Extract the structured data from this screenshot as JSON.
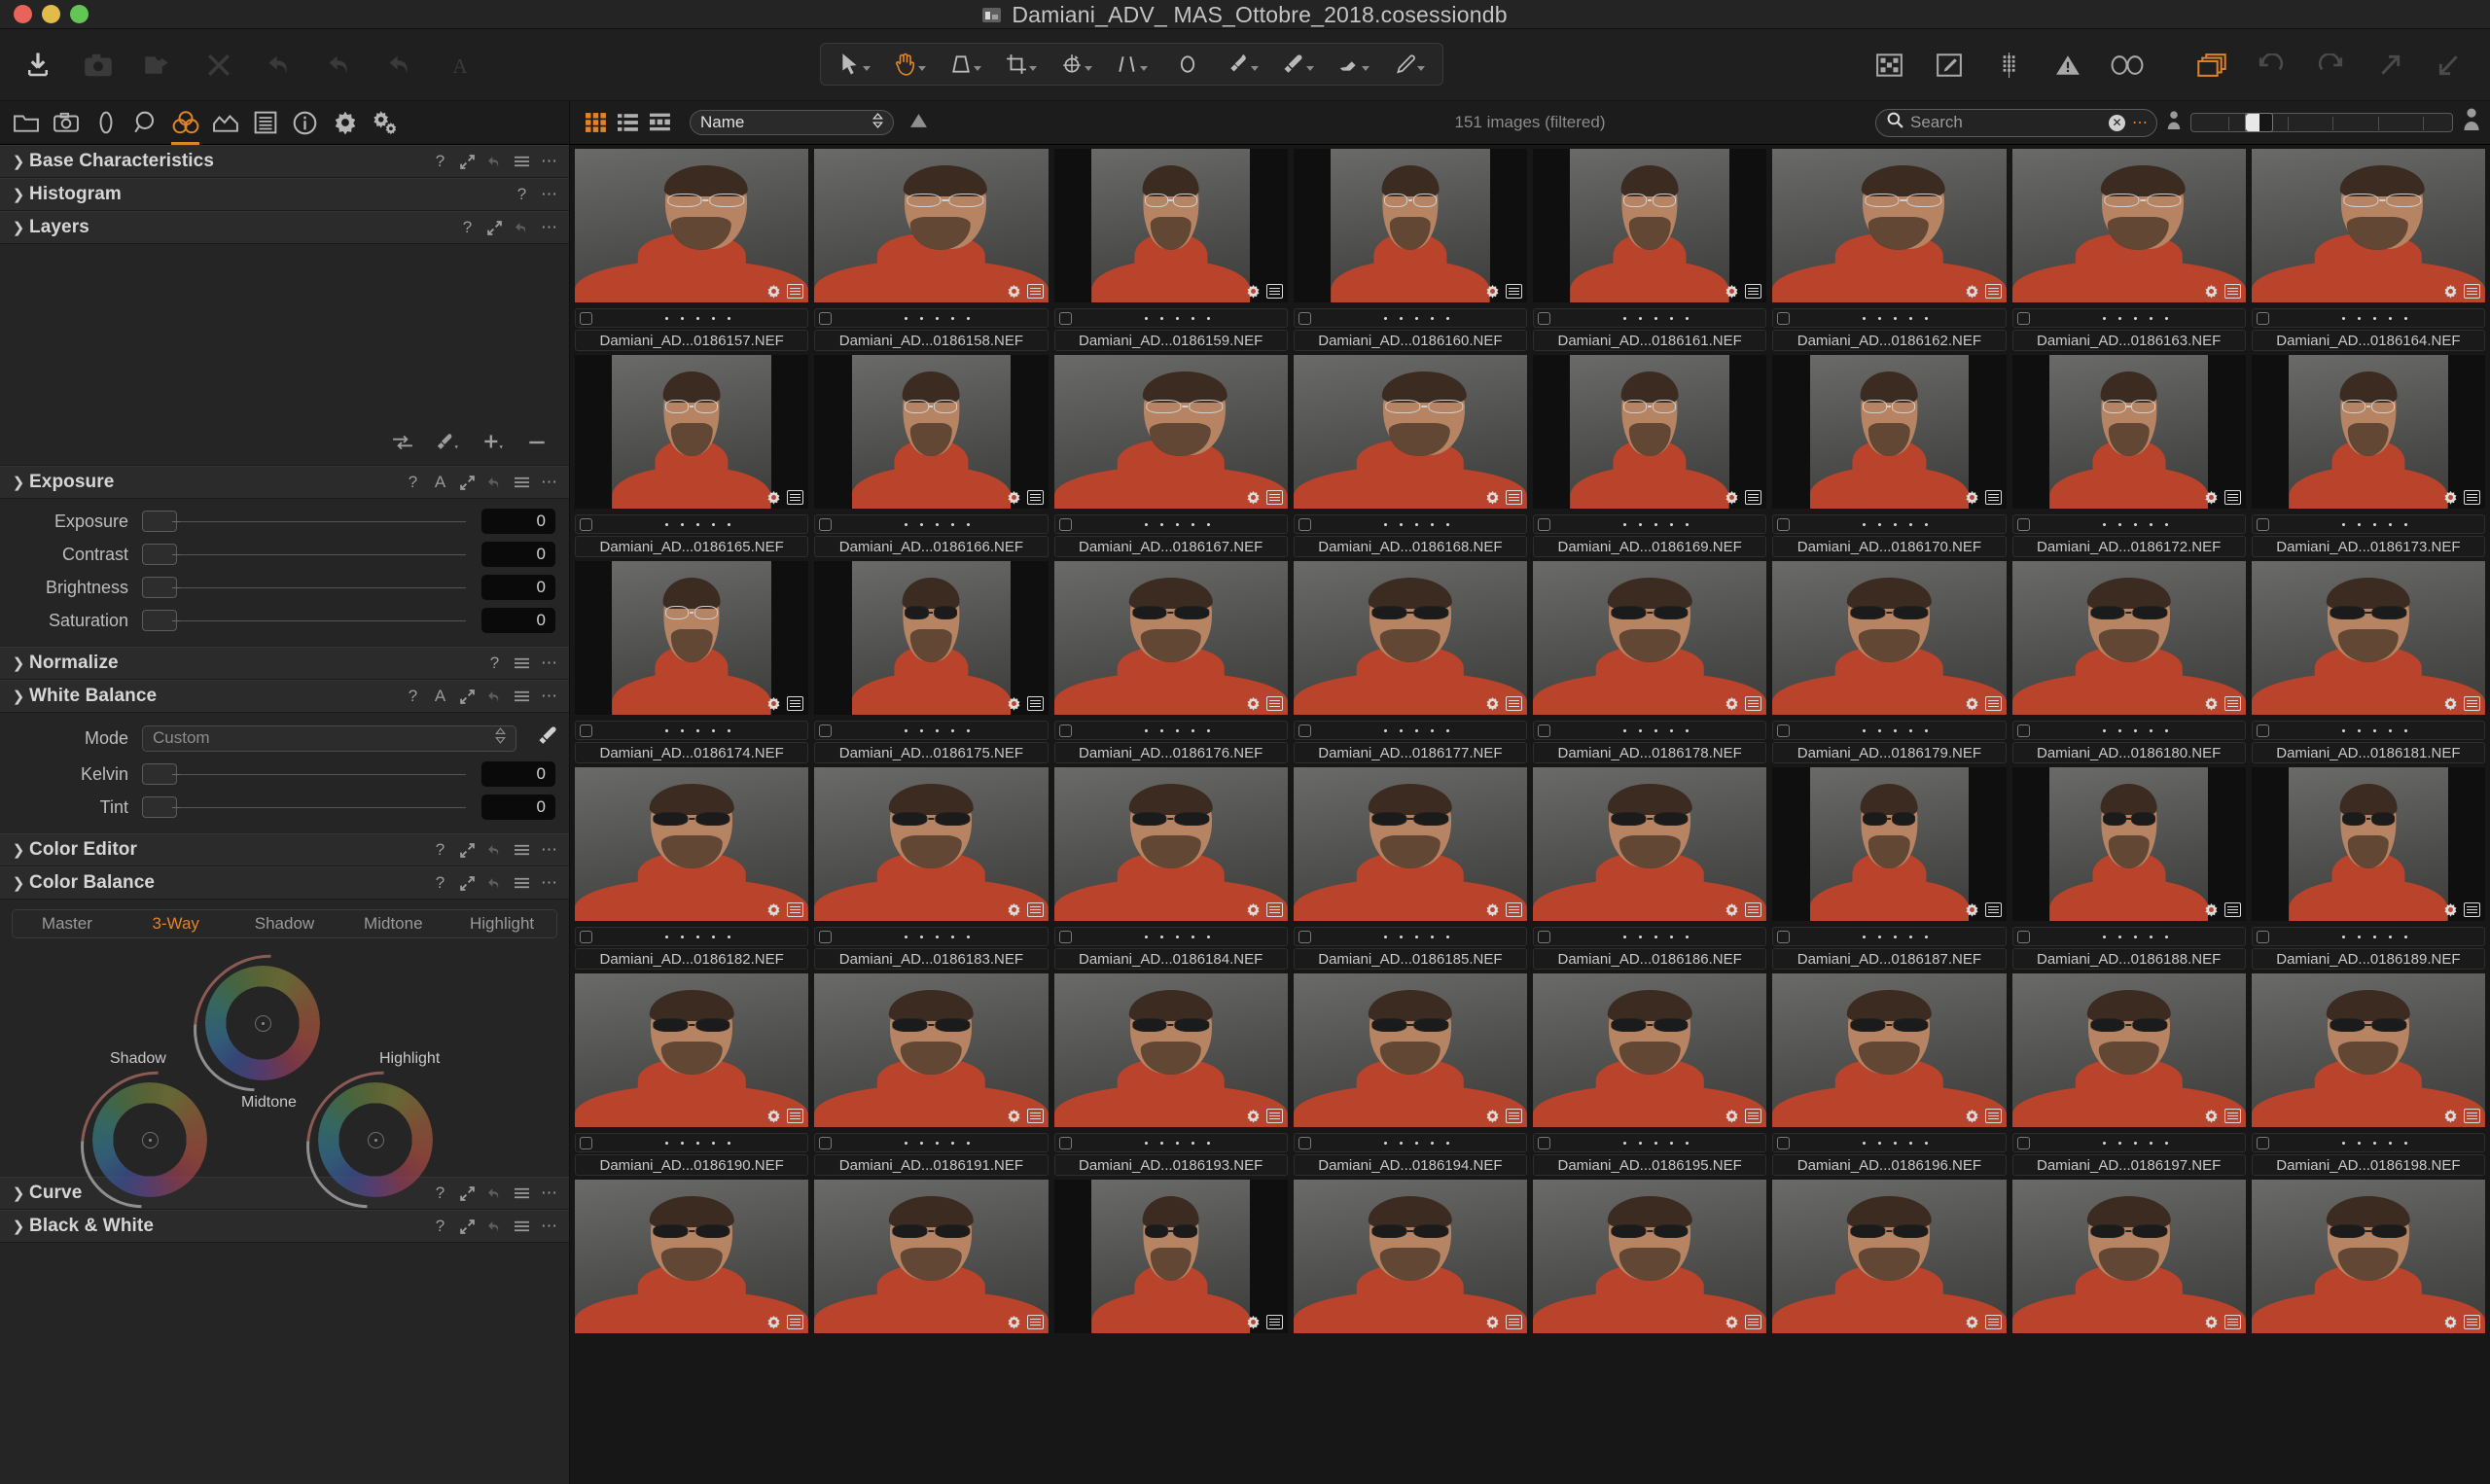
{
  "window": {
    "title": "Damiani_ADV_ MAS_Ottobre_2018.cosessiondb",
    "traffic": [
      "close",
      "minimize",
      "zoom"
    ]
  },
  "main_toolbar": {
    "left_buttons": [
      {
        "name": "import-images",
        "icon": "download-arrow",
        "state": "enabled"
      },
      {
        "name": "capture",
        "icon": "camera",
        "state": "disabled"
      },
      {
        "name": "export-originals",
        "icon": "folder-arrow",
        "state": "disabled"
      },
      {
        "name": "delete",
        "icon": "x-mark",
        "state": "disabled"
      },
      {
        "name": "rotate-left",
        "icon": "undo-arrow",
        "state": "disabled"
      },
      {
        "name": "rotate-right",
        "icon": "redo-arrow",
        "state": "disabled"
      },
      {
        "name": "flip",
        "icon": "curve-arrow",
        "state": "disabled"
      },
      {
        "name": "annotate",
        "icon": "letter-a",
        "state": "disabled"
      }
    ],
    "tools": [
      {
        "name": "select-tool",
        "icon": "cursor-arrow",
        "active": false,
        "has_caret": true
      },
      {
        "name": "pan-tool",
        "icon": "hand",
        "active": true,
        "has_caret": true
      },
      {
        "name": "transform-tool",
        "icon": "keystone",
        "active": false,
        "has_caret": true
      },
      {
        "name": "crop-tool",
        "icon": "crop",
        "active": false,
        "has_caret": true
      },
      {
        "name": "rotate-tool",
        "icon": "rotate-target",
        "active": false,
        "has_caret": true
      },
      {
        "name": "keystone-tool",
        "icon": "parallel-lines",
        "active": false,
        "has_caret": true
      },
      {
        "name": "spot-removal-tool",
        "icon": "circle",
        "active": false,
        "has_caret": false
      },
      {
        "name": "draw-mask-tool",
        "icon": "brush",
        "active": false,
        "has_caret": true
      },
      {
        "name": "color-picker-tool",
        "icon": "eyedropper",
        "active": false,
        "has_caret": true
      },
      {
        "name": "erase-mask-tool",
        "icon": "eraser",
        "active": false,
        "has_caret": true
      },
      {
        "name": "heal-tool",
        "icon": "pen",
        "active": false,
        "has_caret": true
      }
    ],
    "right_buttons": [
      {
        "name": "viewer-toggle",
        "icon": "grid-viewer",
        "state": "enabled"
      },
      {
        "name": "edit-mode",
        "icon": "pencil-box",
        "state": "enabled"
      },
      {
        "name": "grid-overlay",
        "icon": "halftone-grid",
        "state": "enabled"
      },
      {
        "name": "exposure-warning",
        "icon": "warning-triangle",
        "state": "enabled"
      },
      {
        "name": "focus-mask",
        "icon": "glasses",
        "state": "enabled"
      },
      {
        "name": "variants",
        "icon": "stacked-layers",
        "state": "active"
      },
      {
        "name": "undo",
        "icon": "undo-circle",
        "state": "disabled"
      },
      {
        "name": "redo",
        "icon": "redo-circle",
        "state": "disabled"
      },
      {
        "name": "expand-panel",
        "icon": "arrow-up-right",
        "state": "disabled"
      },
      {
        "name": "collapse-panel",
        "icon": "arrow-down-left",
        "state": "disabled"
      }
    ]
  },
  "tool_tabs": [
    {
      "name": "library",
      "icon": "folder",
      "active": false
    },
    {
      "name": "capture",
      "icon": "camera",
      "active": false
    },
    {
      "name": "lens",
      "icon": "lens",
      "active": false
    },
    {
      "name": "details",
      "icon": "magnifier",
      "active": false
    },
    {
      "name": "color",
      "icon": "color-circles",
      "active": true
    },
    {
      "name": "exposure",
      "icon": "histogram-curve",
      "active": false
    },
    {
      "name": "metadata",
      "icon": "document-lines",
      "active": false
    },
    {
      "name": "adjustments",
      "icon": "info-circle",
      "active": false
    },
    {
      "name": "output",
      "icon": "gear",
      "active": false
    },
    {
      "name": "batch",
      "icon": "gears",
      "active": false
    }
  ],
  "panels": [
    {
      "title": "Base Characteristics",
      "expanded": false,
      "icons": [
        "help",
        "expand",
        "reset",
        "menu",
        "more"
      ]
    },
    {
      "title": "Histogram",
      "expanded": false,
      "icons": [
        "help",
        "more"
      ]
    },
    {
      "title": "Layers",
      "expanded": true,
      "icons": [
        "help",
        "expand",
        "reset",
        "more"
      ]
    }
  ],
  "layers": {
    "tool_icons": [
      "fill-mask",
      "brush",
      "add-layer",
      "remove-layer"
    ]
  },
  "exposure_panel": {
    "title": "Exposure",
    "expanded": true,
    "icons": [
      "help",
      "auto",
      "expand",
      "reset",
      "menu",
      "more"
    ],
    "sliders": [
      {
        "label": "Exposure",
        "value": "0"
      },
      {
        "label": "Contrast",
        "value": "0"
      },
      {
        "label": "Brightness",
        "value": "0"
      },
      {
        "label": "Saturation",
        "value": "0"
      }
    ]
  },
  "normalize_panel": {
    "title": "Normalize",
    "expanded": false,
    "icons": [
      "help",
      "menu",
      "more"
    ]
  },
  "white_balance_panel": {
    "title": "White Balance",
    "expanded": true,
    "icons": [
      "help",
      "auto",
      "expand",
      "reset",
      "menu",
      "more"
    ],
    "mode_label": "Mode",
    "mode_value": "Custom",
    "sliders": [
      {
        "label": "Kelvin",
        "value": "0"
      },
      {
        "label": "Tint",
        "value": "0"
      }
    ]
  },
  "color_editor_panel": {
    "title": "Color Editor",
    "expanded": false,
    "icons": [
      "help",
      "expand",
      "reset",
      "menu",
      "more"
    ]
  },
  "color_balance_panel": {
    "title": "Color Balance",
    "expanded": true,
    "icons": [
      "help",
      "expand",
      "reset",
      "menu",
      "more"
    ],
    "tabs": [
      {
        "label": "Master",
        "active": false
      },
      {
        "label": "3-Way",
        "active": true
      },
      {
        "label": "Shadow",
        "active": false
      },
      {
        "label": "Midtone",
        "active": false
      },
      {
        "label": "Highlight",
        "active": false
      }
    ],
    "wheels": [
      {
        "label": "Midtone"
      },
      {
        "label": "Shadow"
      },
      {
        "label": "Highlight"
      }
    ]
  },
  "curve_panel": {
    "title": "Curve",
    "expanded": false,
    "icons": [
      "help",
      "expand",
      "reset",
      "menu",
      "more"
    ]
  },
  "black_white_panel": {
    "title": "Black & White",
    "expanded": false,
    "icons": [
      "help",
      "expand",
      "reset",
      "menu",
      "more"
    ]
  },
  "browser": {
    "view_modes": [
      {
        "name": "grid-view",
        "active": true
      },
      {
        "name": "list-view",
        "active": false
      },
      {
        "name": "filmstrip-view",
        "active": false
      }
    ],
    "sort_field": "Name",
    "sort_direction": "ascending",
    "count_text": "151 images (filtered)",
    "search_placeholder": "Search",
    "search_value": "",
    "zoom_level": 20
  },
  "accent_color": "#e08427",
  "thumbnails": [
    {
      "filename": "Damiani_AD...0186157.NEF",
      "rating": 0,
      "checked": false,
      "pose": "glasses-left",
      "aspect": "landscape"
    },
    {
      "filename": "Damiani_AD...0186158.NEF",
      "rating": 0,
      "checked": false,
      "pose": "glasses-left",
      "aspect": "landscape"
    },
    {
      "filename": "Damiani_AD...0186159.NEF",
      "rating": 0,
      "checked": false,
      "pose": "glasses-front",
      "aspect": "portrait"
    },
    {
      "filename": "Damiani_AD...0186160.NEF",
      "rating": 0,
      "checked": false,
      "pose": "glasses-front",
      "aspect": "portrait"
    },
    {
      "filename": "Damiani_AD...0186161.NEF",
      "rating": 0,
      "checked": false,
      "pose": "glasses-front",
      "aspect": "portrait"
    },
    {
      "filename": "Damiani_AD...0186162.NEF",
      "rating": 0,
      "checked": false,
      "pose": "glasses-left",
      "aspect": "landscape"
    },
    {
      "filename": "Damiani_AD...0186163.NEF",
      "rating": 0,
      "checked": false,
      "pose": "glasses-left",
      "aspect": "landscape"
    },
    {
      "filename": "Damiani_AD...0186164.NEF",
      "rating": 0,
      "checked": false,
      "pose": "glasses-left",
      "aspect": "landscape"
    },
    {
      "filename": "Damiani_AD...0186165.NEF",
      "rating": 0,
      "checked": false,
      "pose": "glasses-front",
      "aspect": "portrait"
    },
    {
      "filename": "Damiani_AD...0186166.NEF",
      "rating": 0,
      "checked": false,
      "pose": "glasses-front",
      "aspect": "portrait"
    },
    {
      "filename": "Damiani_AD...0186167.NEF",
      "rating": 0,
      "checked": false,
      "pose": "glasses-left",
      "aspect": "landscape"
    },
    {
      "filename": "Damiani_AD...0186168.NEF",
      "rating": 0,
      "checked": false,
      "pose": "glasses-left",
      "aspect": "landscape"
    },
    {
      "filename": "Damiani_AD...0186169.NEF",
      "rating": 0,
      "checked": false,
      "pose": "glasses-front",
      "aspect": "portrait"
    },
    {
      "filename": "Damiani_AD...0186170.NEF",
      "rating": 0,
      "checked": false,
      "pose": "glasses-front",
      "aspect": "portrait"
    },
    {
      "filename": "Damiani_AD...0186172.NEF",
      "rating": 0,
      "checked": false,
      "pose": "glasses-front",
      "aspect": "portrait"
    },
    {
      "filename": "Damiani_AD...0186173.NEF",
      "rating": 0,
      "checked": false,
      "pose": "glasses-front",
      "aspect": "portrait"
    },
    {
      "filename": "Damiani_AD...0186174.NEF",
      "rating": 0,
      "checked": false,
      "pose": "glasses-front",
      "aspect": "portrait"
    },
    {
      "filename": "Damiani_AD...0186175.NEF",
      "rating": 0,
      "checked": false,
      "pose": "sunglasses",
      "aspect": "portrait"
    },
    {
      "filename": "Damiani_AD...0186176.NEF",
      "rating": 0,
      "checked": false,
      "pose": "sunglasses",
      "aspect": "landscape"
    },
    {
      "filename": "Damiani_AD...0186177.NEF",
      "rating": 0,
      "checked": false,
      "pose": "sunglasses",
      "aspect": "landscape"
    },
    {
      "filename": "Damiani_AD...0186178.NEF",
      "rating": 0,
      "checked": false,
      "pose": "sunglasses",
      "aspect": "landscape"
    },
    {
      "filename": "Damiani_AD...0186179.NEF",
      "rating": 0,
      "checked": false,
      "pose": "sunglasses",
      "aspect": "landscape"
    },
    {
      "filename": "Damiani_AD...0186180.NEF",
      "rating": 0,
      "checked": false,
      "pose": "sunglasses",
      "aspect": "landscape"
    },
    {
      "filename": "Damiani_AD...0186181.NEF",
      "rating": 0,
      "checked": false,
      "pose": "sunglasses",
      "aspect": "landscape"
    },
    {
      "filename": "Damiani_AD...0186182.NEF",
      "rating": 0,
      "checked": false,
      "pose": "sunglasses",
      "aspect": "landscape"
    },
    {
      "filename": "Damiani_AD...0186183.NEF",
      "rating": 0,
      "checked": false,
      "pose": "sunglasses",
      "aspect": "landscape"
    },
    {
      "filename": "Damiani_AD...0186184.NEF",
      "rating": 0,
      "checked": false,
      "pose": "sunglasses",
      "aspect": "landscape"
    },
    {
      "filename": "Damiani_AD...0186185.NEF",
      "rating": 0,
      "checked": false,
      "pose": "sunglasses",
      "aspect": "landscape"
    },
    {
      "filename": "Damiani_AD...0186186.NEF",
      "rating": 0,
      "checked": false,
      "pose": "sunglasses",
      "aspect": "landscape"
    },
    {
      "filename": "Damiani_AD...0186187.NEF",
      "rating": 0,
      "checked": false,
      "pose": "sunglasses",
      "aspect": "portrait"
    },
    {
      "filename": "Damiani_AD...0186188.NEF",
      "rating": 0,
      "checked": false,
      "pose": "sunglasses",
      "aspect": "portrait"
    },
    {
      "filename": "Damiani_AD...0186189.NEF",
      "rating": 0,
      "checked": false,
      "pose": "sunglasses",
      "aspect": "portrait"
    },
    {
      "filename": "Damiani_AD...0186190.NEF",
      "rating": 0,
      "checked": false,
      "pose": "sunglasses",
      "aspect": "landscape"
    },
    {
      "filename": "Damiani_AD...0186191.NEF",
      "rating": 0,
      "checked": false,
      "pose": "sunglasses",
      "aspect": "landscape"
    },
    {
      "filename": "Damiani_AD...0186193.NEF",
      "rating": 0,
      "checked": false,
      "pose": "sunglasses",
      "aspect": "landscape"
    },
    {
      "filename": "Damiani_AD...0186194.NEF",
      "rating": 0,
      "checked": false,
      "pose": "sunglasses",
      "aspect": "landscape"
    },
    {
      "filename": "Damiani_AD...0186195.NEF",
      "rating": 0,
      "checked": false,
      "pose": "sunglasses",
      "aspect": "landscape"
    },
    {
      "filename": "Damiani_AD...0186196.NEF",
      "rating": 0,
      "checked": false,
      "pose": "sunglasses",
      "aspect": "landscape"
    },
    {
      "filename": "Damiani_AD...0186197.NEF",
      "rating": 0,
      "checked": false,
      "pose": "sunglasses",
      "aspect": "landscape"
    },
    {
      "filename": "Damiani_AD...0186198.NEF",
      "rating": 0,
      "checked": false,
      "pose": "sunglasses",
      "aspect": "landscape"
    },
    {
      "filename": "",
      "rating": 0,
      "checked": false,
      "pose": "sunglasses",
      "aspect": "landscape"
    },
    {
      "filename": "",
      "rating": 0,
      "checked": false,
      "pose": "sunglasses",
      "aspect": "landscape"
    },
    {
      "filename": "",
      "rating": 0,
      "checked": false,
      "pose": "sunglasses",
      "aspect": "portrait"
    },
    {
      "filename": "",
      "rating": 0,
      "checked": false,
      "pose": "sunglasses",
      "aspect": "landscape"
    },
    {
      "filename": "",
      "rating": 0,
      "checked": false,
      "pose": "sunglasses",
      "aspect": "landscape"
    },
    {
      "filename": "",
      "rating": 0,
      "checked": false,
      "pose": "sunglasses",
      "aspect": "landscape"
    },
    {
      "filename": "",
      "rating": 0,
      "checked": false,
      "pose": "sunglasses",
      "aspect": "landscape"
    },
    {
      "filename": "",
      "rating": 0,
      "checked": false,
      "pose": "sunglasses",
      "aspect": "landscape"
    }
  ]
}
